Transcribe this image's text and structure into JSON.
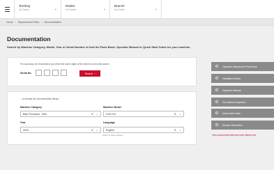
{
  "header": {
    "menu_icon": "hamburger-icon",
    "territory": {
      "label": "Territory",
      "value": "No Dealer"
    },
    "dealer": {
      "label": "Dealer",
      "value": "No Dealer"
    },
    "branch": {
      "label": "Branch",
      "value": "No Dealer"
    }
  },
  "breadcrumb": [
    "Home",
    "Replacement Parts",
    "Documentation"
  ],
  "page": {
    "title": "Documentation",
    "subtitle": "Search by Machine Category, Model, Year or Serial Number to find the Parts Book, Operator Manual or Quick Start Guide for your machine."
  },
  "serial_search": {
    "hint": "For accuracy, we recommend you enter the last 8 digits of the serial no and click search",
    "label": "Serial No.",
    "button_label": "Search",
    "button_icon": "arrow-right-icon"
  },
  "browse": {
    "intro": "...or browse the documentation library",
    "machine_category": {
      "label": "Machine Category",
      "value": "Bale Processor - Brie"
    },
    "machine_model": {
      "label": "Machine Model",
      "value": "9101 SH"
    },
    "year": {
      "label": "Year",
      "value": "2024"
    },
    "language": {
      "label": "Language",
      "value": "English"
    },
    "language_note": "English is always allowed"
  },
  "side_menu": [
    {
      "label": "Operators Manual and Parts Book",
      "icon": "gear-icon"
    },
    {
      "label": "Installation Advice",
      "icon": "gear-icon"
    },
    {
      "label": "Operators Manual",
      "icon": "gear-icon"
    },
    {
      "label": "Pre-delivery Inspection",
      "icon": "gear-icon"
    },
    {
      "label": "Quick Start Guide",
      "icon": "gear-icon"
    },
    {
      "label": "Service Information",
      "icon": "gear-icon"
    }
  ],
  "side_link": "View documents that have been filtered out",
  "colors": {
    "accent": "#c8102e",
    "side_button": "#8a8a8a",
    "background": "#efefef"
  }
}
